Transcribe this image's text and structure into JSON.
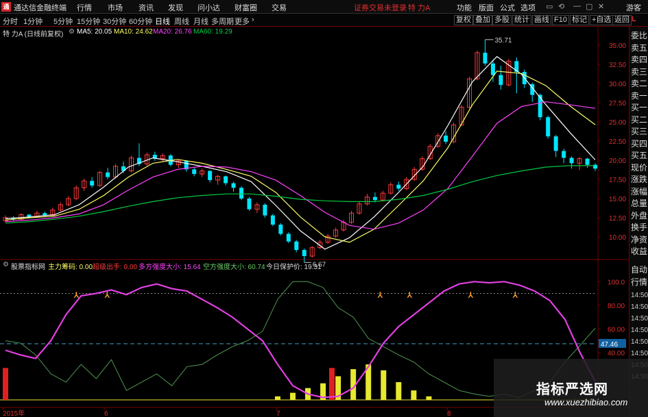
{
  "titlebar": {
    "app_title": "通达信金融终端",
    "menus": [
      "行情",
      "市场",
      "资讯",
      "发现",
      "问小达",
      "财富圈",
      "交易"
    ],
    "login_status": "证券交易未登录",
    "stock_name": "特 力A",
    "right_menus": [
      "功能",
      "版面",
      "公式",
      "选项"
    ],
    "window_buttons": [
      "▭",
      "⟲",
      "—",
      "▢",
      "✕"
    ],
    "guest_label": "游客"
  },
  "toolbar": {
    "periods": [
      "分时",
      "1分钟",
      "5分钟",
      "15分钟",
      "30分钟",
      "60分钟",
      "日线",
      "周线",
      "月线",
      "多周期",
      "更多"
    ],
    "active_period": "日线",
    "buttons": [
      "复权",
      "叠加",
      "多股",
      "统计",
      "画线",
      "F10",
      "标记",
      "+自选",
      "返回"
    ]
  },
  "main_info": {
    "title": "特 力A (日线前复权)",
    "ma5": "MA5: 20.05",
    "ma10": "MA10: 24.62",
    "ma20": "MA20: 26.76",
    "ma60": "MA60: 19.29"
  },
  "indicator_info": {
    "name": "股票指标网",
    "main_chip": "主力筹码: 0.00",
    "extreme_sell": "超级出手: 0.00",
    "long_strength": "多方强度大小: 15.64",
    "short_strength": "空方强度大小: 60.74",
    "protect_price": "今日保护价: 19.31"
  },
  "sidebar": {
    "corner": "L",
    "items": [
      "委比",
      "卖五",
      "卖四",
      "卖三",
      "卖二",
      "卖一",
      "买一",
      "买二",
      "买三",
      "买四",
      "买五",
      "现价",
      "涨跌",
      "涨幅",
      "总量",
      "外盘",
      "换手",
      "净资",
      "收益",
      "自动",
      "行情",
      "14:50",
      "14:50",
      "14:50",
      "14:50",
      "14:50",
      "14:50",
      "14:50",
      "14:50"
    ]
  },
  "annotations": {
    "high": "35.71",
    "low": "6.67",
    "current_level": "47.46"
  },
  "x_labels": [
    "2015年",
    "6",
    "7",
    "8"
  ],
  "colors": {
    "up": "#ff3c3c",
    "down": "#00e5ff",
    "ma5": "#ffffff",
    "ma10": "#ffff66",
    "ma20": "#ff44ff",
    "ma60": "#00cc44",
    "magenta_line": "#e040e0",
    "green_line": "#4a8a4a",
    "yellow_bars": "#e8e830",
    "red_bars": "#e02020"
  },
  "chart_data": [
    {
      "type": "line",
      "title": "特 力A (日线前复权)",
      "ylim": [
        7.5,
        36.5
      ],
      "y_ticks": [
        "35.00",
        "32.50",
        "30.00",
        "27.50",
        "25.00",
        "22.50",
        "20.00",
        "17.50",
        "15.00",
        "12.50",
        "10.00"
      ],
      "series": [
        {
          "name": "MA5",
          "values": [
            12.4,
            12.6,
            12.9,
            14.2,
            16.5,
            19.1,
            20.3,
            19.8,
            19.2,
            18.5,
            17.2,
            14.1,
            10.8,
            8.4,
            9.9,
            12.6,
            15.8,
            19.2,
            24.5,
            30.2,
            33.5,
            31.2,
            27.2,
            23.5,
            20.05
          ]
        },
        {
          "name": "MA10",
          "values": [
            12.2,
            12.5,
            12.7,
            13.6,
            15.4,
            17.8,
            19.6,
            20.1,
            19.6,
            18.8,
            17.9,
            15.8,
            12.6,
            10.0,
            9.3,
            11.0,
            14.1,
            17.3,
            21.6,
            27.2,
            31.6,
            31.3,
            29.7,
            27.0,
            24.62
          ]
        },
        {
          "name": "MA20",
          "values": [
            12.0,
            12.2,
            12.5,
            13.0,
            14.2,
            16.1,
            17.8,
            18.8,
            19.2,
            19.1,
            18.5,
            17.4,
            15.4,
            13.2,
            11.5,
            11.0,
            11.8,
            13.5,
            16.3,
            20.5,
            24.8,
            27.0,
            27.6,
            27.2,
            26.76
          ]
        },
        {
          "name": "MA60",
          "values": [
            11.8,
            12.0,
            12.3,
            12.7,
            13.3,
            14.0,
            14.6,
            15.1,
            15.4,
            15.6,
            15.6,
            15.3,
            14.9,
            14.7,
            14.6,
            14.6,
            14.9,
            15.4,
            16.2,
            17.2,
            18.0,
            18.6,
            19.1,
            19.3,
            19.29
          ]
        }
      ],
      "candles": [
        [
          12.1,
          12.5,
          12.8,
          11.9
        ],
        [
          12.5,
          12.3,
          12.7,
          12.1
        ],
        [
          12.3,
          12.9,
          13.1,
          12.2
        ],
        [
          12.9,
          12.6,
          13.0,
          12.4
        ],
        [
          12.6,
          13.1,
          13.4,
          12.5
        ],
        [
          13.1,
          12.8,
          13.3,
          12.7
        ],
        [
          12.8,
          13.5,
          13.8,
          12.7
        ],
        [
          13.5,
          14.2,
          14.5,
          13.3
        ],
        [
          14.2,
          15.0,
          15.3,
          14.0
        ],
        [
          15.0,
          16.4,
          16.7,
          14.8
        ],
        [
          16.4,
          17.3,
          17.6,
          16.0
        ],
        [
          17.3,
          16.7,
          17.8,
          16.4
        ],
        [
          16.7,
          18.4,
          18.6,
          16.5
        ],
        [
          18.4,
          17.8,
          19.0,
          17.5
        ],
        [
          17.8,
          19.2,
          19.5,
          17.6
        ],
        [
          19.2,
          18.6,
          19.8,
          18.3
        ],
        [
          18.6,
          20.3,
          20.6,
          18.4
        ],
        [
          20.3,
          19.5,
          22.2,
          19.2
        ],
        [
          19.5,
          20.7,
          21.0,
          19.3
        ],
        [
          20.7,
          20.2,
          21.1,
          19.9
        ],
        [
          20.2,
          20.6,
          20.9,
          19.8
        ],
        [
          20.6,
          19.4,
          20.8,
          19.2
        ],
        [
          19.4,
          19.9,
          20.1,
          19.0
        ],
        [
          19.9,
          18.8,
          20.0,
          18.5
        ],
        [
          18.8,
          18.2,
          19.1,
          17.9
        ],
        [
          18.2,
          18.6,
          18.9,
          17.8
        ],
        [
          18.6,
          17.4,
          18.7,
          17.1
        ],
        [
          17.4,
          17.9,
          18.1,
          16.8
        ],
        [
          17.9,
          17.0,
          18.0,
          16.7
        ],
        [
          17.0,
          16.4,
          17.2,
          15.9
        ],
        [
          16.4,
          15.0,
          16.6,
          14.8
        ],
        [
          15.0,
          13.6,
          15.2,
          13.4
        ],
        [
          13.6,
          14.2,
          14.5,
          13.1
        ],
        [
          14.2,
          12.8,
          14.4,
          12.5
        ],
        [
          12.8,
          11.6,
          13.0,
          11.4
        ],
        [
          11.6,
          10.4,
          11.8,
          10.2
        ],
        [
          10.4,
          9.4,
          10.6,
          9.2
        ],
        [
          9.4,
          8.3,
          9.6,
          8.0
        ],
        [
          8.3,
          7.5,
          8.5,
          6.67
        ],
        [
          7.5,
          8.6,
          8.8,
          7.3
        ],
        [
          8.6,
          9.3,
          9.6,
          8.4
        ],
        [
          9.3,
          10.1,
          10.4,
          9.1
        ],
        [
          10.1,
          10.9,
          11.2,
          9.9
        ],
        [
          10.9,
          11.9,
          12.2,
          10.7
        ],
        [
          11.9,
          13.1,
          13.4,
          11.7
        ],
        [
          13.1,
          14.3,
          14.6,
          12.9
        ],
        [
          14.3,
          15.2,
          15.6,
          14.1
        ],
        [
          15.2,
          14.8,
          15.8,
          14.5
        ],
        [
          14.8,
          15.7,
          16.0,
          14.6
        ],
        [
          15.7,
          16.8,
          17.1,
          15.5
        ],
        [
          16.8,
          16.3,
          17.2,
          16.0
        ],
        [
          16.3,
          17.5,
          17.8,
          16.1
        ],
        [
          17.5,
          18.8,
          19.1,
          17.3
        ],
        [
          18.8,
          20.2,
          20.5,
          18.6
        ],
        [
          20.2,
          21.8,
          22.1,
          20.0
        ],
        [
          21.8,
          23.2,
          23.5,
          21.6
        ],
        [
          23.2,
          22.4,
          23.8,
          22.1
        ],
        [
          22.4,
          24.6,
          24.9,
          22.2
        ],
        [
          24.6,
          26.9,
          27.2,
          24.4
        ],
        [
          26.9,
          30.6,
          30.9,
          26.7
        ],
        [
          30.6,
          34.0,
          34.3,
          30.4
        ],
        [
          34.0,
          32.6,
          35.71,
          32.3
        ],
        [
          32.6,
          31.1,
          33.1,
          30.2
        ],
        [
          31.1,
          29.8,
          32.3,
          29.2
        ],
        [
          29.8,
          32.9,
          33.2,
          29.6
        ],
        [
          32.9,
          31.5,
          33.4,
          28.7
        ],
        [
          31.5,
          29.9,
          31.8,
          29.4
        ],
        [
          29.9,
          28.5,
          30.1,
          27.6
        ],
        [
          28.5,
          25.6,
          28.7,
          25.2
        ],
        [
          25.6,
          23.1,
          25.8,
          22.8
        ],
        [
          23.1,
          21.2,
          23.3,
          20.4
        ],
        [
          21.2,
          20.3,
          21.5,
          19.6
        ],
        [
          20.3,
          19.6,
          20.5,
          18.9
        ],
        [
          19.6,
          20.2,
          20.4,
          18.7
        ],
        [
          20.2,
          19.4,
          20.3,
          19.0
        ],
        [
          19.4,
          18.9,
          19.6,
          18.6
        ]
      ]
    },
    {
      "type": "line",
      "title": "股票指标网",
      "ylim": [
        0,
        110
      ],
      "y_ticks": [
        "100.0",
        "80.00",
        "60.00",
        "40.00"
      ],
      "reference_levels": [
        90,
        47.46
      ],
      "series": [
        {
          "name": "多方强度大小",
          "values": [
            42,
            38,
            35,
            50,
            72,
            88,
            90,
            93,
            89,
            95,
            98,
            94,
            92,
            85,
            78,
            70,
            60,
            50,
            30,
            12,
            5,
            2,
            3,
            10,
            28,
            48,
            62,
            72,
            82,
            92,
            98,
            100,
            99,
            100,
            97,
            92,
            84,
            68,
            40,
            15.64
          ]
        },
        {
          "name": "空方强度大小",
          "values": [
            50,
            48,
            38,
            22,
            15,
            30,
            18,
            34,
            8,
            15,
            22,
            12,
            28,
            30,
            38,
            45,
            50,
            58,
            85,
            100,
            100,
            95,
            78,
            70,
            52,
            45,
            38,
            32,
            22,
            15,
            8,
            5,
            3,
            5,
            2,
            8,
            15,
            32,
            46,
            60.74
          ]
        },
        {
          "name": "主力筹码",
          "values": [
            0,
            0,
            0,
            0,
            0,
            0,
            0,
            0,
            0,
            0,
            0,
            0,
            0,
            0,
            0,
            0,
            0,
            0,
            3,
            6,
            10,
            14,
            20,
            26,
            30,
            25,
            15,
            8,
            3,
            0,
            0,
            0,
            0,
            0,
            0,
            0,
            0,
            0,
            0,
            0
          ]
        }
      ]
    }
  ]
}
